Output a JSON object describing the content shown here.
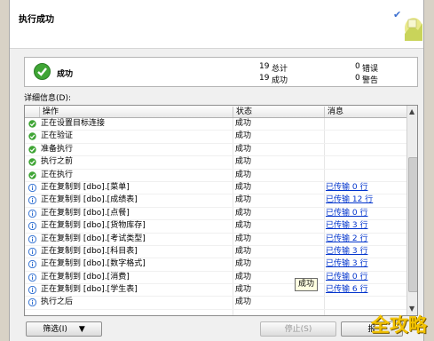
{
  "header": {
    "title": "执行成功"
  },
  "summary": {
    "status": "成功",
    "total_count": "19",
    "total_label": "总计",
    "success_count": "19",
    "success_label": "成功",
    "error_count": "0",
    "error_label": "错误",
    "warning_count": "0",
    "warning_label": "警告"
  },
  "details_label": "详细信息(D):",
  "grid": {
    "columns": [
      "操作",
      "状态",
      "消息"
    ],
    "rows": [
      {
        "icon": "success",
        "op": "正在设置目标连接",
        "status": "成功",
        "msg": ""
      },
      {
        "icon": "success",
        "op": "正在验证",
        "status": "成功",
        "msg": ""
      },
      {
        "icon": "success",
        "op": "准备执行",
        "status": "成功",
        "msg": ""
      },
      {
        "icon": "success",
        "op": "执行之前",
        "status": "成功",
        "msg": ""
      },
      {
        "icon": "success",
        "op": "正在执行",
        "status": "成功",
        "msg": ""
      },
      {
        "icon": "info",
        "op": "正在复制到 [dbo].[菜单]",
        "status": "成功",
        "msg": "已传输 0 行"
      },
      {
        "icon": "info",
        "op": "正在复制到 [dbo].[成绩表]",
        "status": "成功",
        "msg": "已传输 12 行"
      },
      {
        "icon": "info",
        "op": "正在复制到 [dbo].[点餐]",
        "status": "成功",
        "msg": "已传输 0 行"
      },
      {
        "icon": "info",
        "op": "正在复制到 [dbo].[货物库存]",
        "status": "成功",
        "msg": "已传输 3 行"
      },
      {
        "icon": "info",
        "op": "正在复制到 [dbo].[考试类型]",
        "status": "成功",
        "msg": "已传输 2 行"
      },
      {
        "icon": "info",
        "op": "正在复制到 [dbo].[科目表]",
        "status": "成功",
        "msg": "已传输 3 行"
      },
      {
        "icon": "info",
        "op": "正在复制到 [dbo].[数字格式]",
        "status": "成功",
        "msg": "已传输 3 行"
      },
      {
        "icon": "info",
        "op": "正在复制到 [dbo].[消费]",
        "status": "成功",
        "msg": "已传输 0 行"
      },
      {
        "icon": "info",
        "op": "正在复制到 [dbo].[学生表]",
        "status": "成功",
        "msg": "已传输 6 行"
      },
      {
        "icon": "info",
        "op": "执行之后",
        "status": "成功",
        "msg": ""
      }
    ]
  },
  "tooltip": "成功",
  "buttons": {
    "filter": "筛选(I)",
    "filter_arrow": "▼",
    "stop": "停止(S)",
    "report": "报"
  },
  "watermark": "全攻略",
  "colors": {
    "success_green": "#3fa535",
    "info_blue": "#2f6fd1",
    "link_blue": "#0033cc"
  }
}
